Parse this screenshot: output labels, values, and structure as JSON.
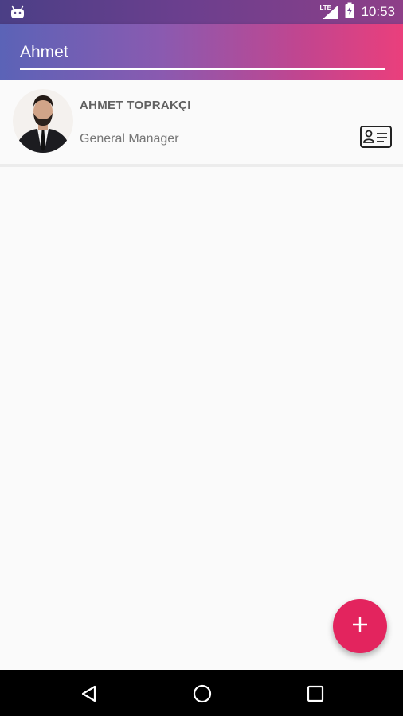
{
  "status_bar": {
    "time": "10:53",
    "network_label": "LTE",
    "icons": [
      "android-icon",
      "lte-signal-icon",
      "battery-charging-icon"
    ]
  },
  "search": {
    "value": "Ahmet",
    "placeholder": ""
  },
  "results": [
    {
      "name": "AHMET TOPRAKÇI",
      "title": "General Manager",
      "avatar_icon": "person-photo",
      "action_icon": "contact-card-icon"
    }
  ],
  "fab": {
    "icon": "plus-icon"
  },
  "nav": {
    "icons": [
      "back-icon",
      "home-icon",
      "recents-icon"
    ]
  },
  "colors": {
    "appbar_start": "#5b63b7",
    "appbar_end": "#ea3f7c",
    "fab": "#e3245e",
    "name_text": "#616161",
    "title_text": "#757575"
  }
}
